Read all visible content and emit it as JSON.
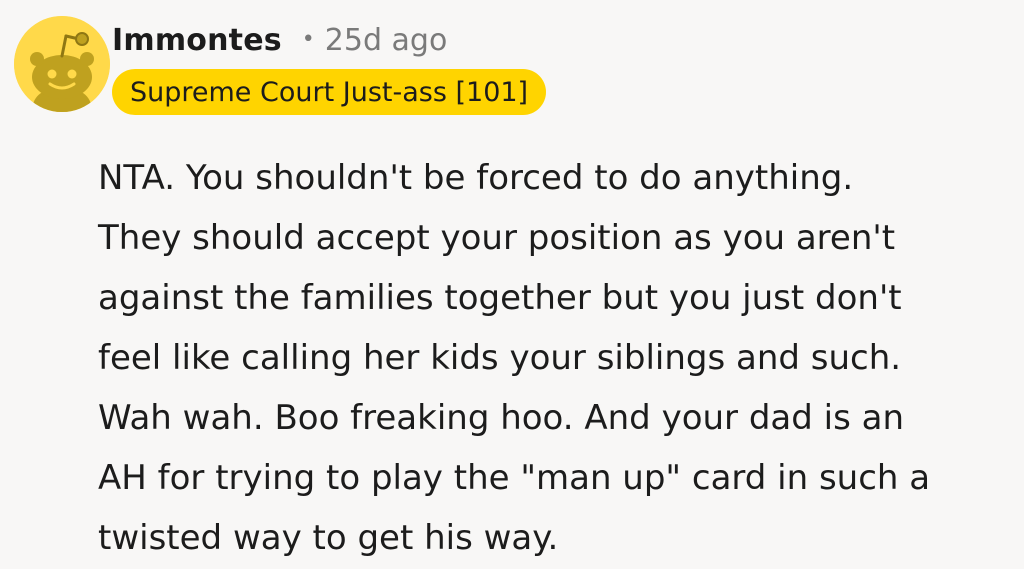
{
  "comment": {
    "avatar_icon": "reddit-snoo-avatar-icon",
    "username": "Immontes",
    "separator": "•",
    "timestamp": "25d ago",
    "flair": "Supreme Court Just-ass [101]",
    "body_lines": [
      "NTA. You shouldn't be forced to do anything.",
      "They should accept your position as you aren't",
      "against the families together but you just don't",
      "feel like calling her kids your siblings and such.",
      "Wah wah. Boo freaking hoo. And your dad is an",
      "AH for trying to play the \"man up\" card in such a",
      "twisted way to get his way."
    ]
  },
  "colors": {
    "background": "#f8f7f6",
    "text": "#1c1c1c",
    "muted_text": "#7a7a7a",
    "flair_background": "#ffd400",
    "avatar_background": "#ffd94a",
    "avatar_figure": "#bfa11f"
  }
}
